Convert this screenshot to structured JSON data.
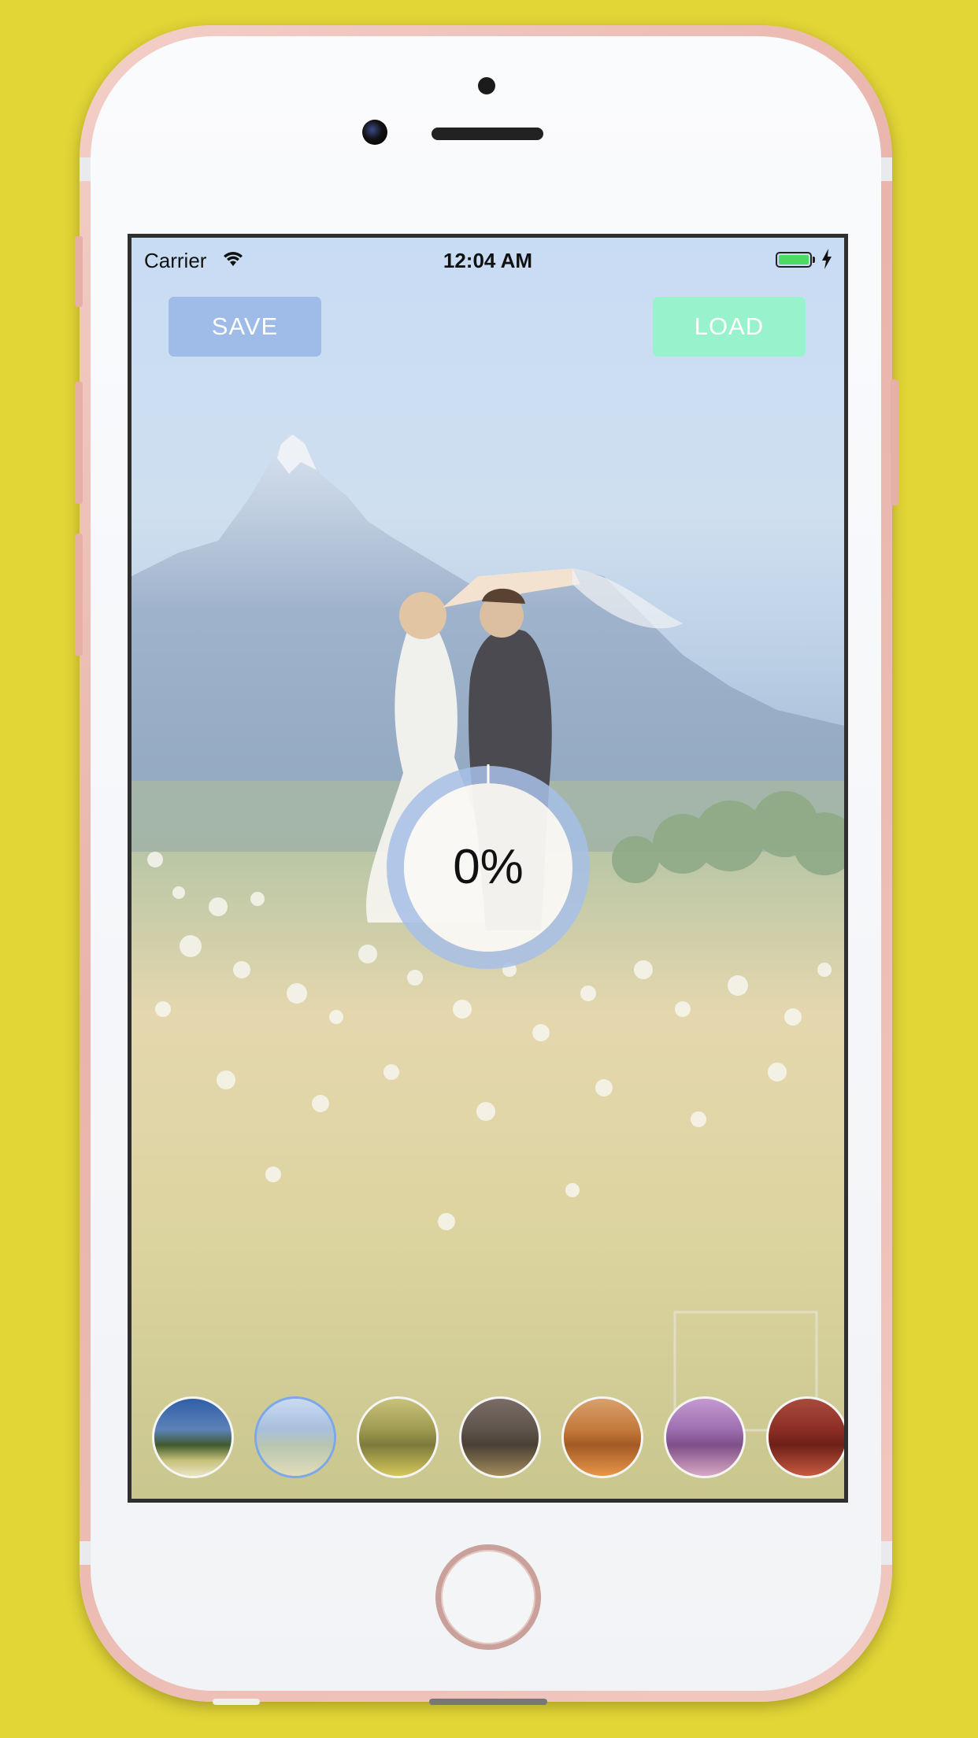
{
  "status_bar": {
    "carrier": "Carrier",
    "time": "12:04 AM",
    "battery_color": "#4cd964"
  },
  "toolbar": {
    "save_label": "SAVE",
    "load_label": "LOAD",
    "save_color": "#9fbbe8",
    "load_color": "#98f2cc"
  },
  "progress": {
    "label": "0%",
    "value": 0,
    "ring_color": "#a7c0e8"
  },
  "filters": [
    {
      "name": "original",
      "selected": false
    },
    {
      "name": "light-blue",
      "selected": true
    },
    {
      "name": "yellow",
      "selected": false
    },
    {
      "name": "sepia-dark",
      "selected": false
    },
    {
      "name": "orange",
      "selected": false
    },
    {
      "name": "purple",
      "selected": false
    },
    {
      "name": "red",
      "selected": false
    }
  ]
}
